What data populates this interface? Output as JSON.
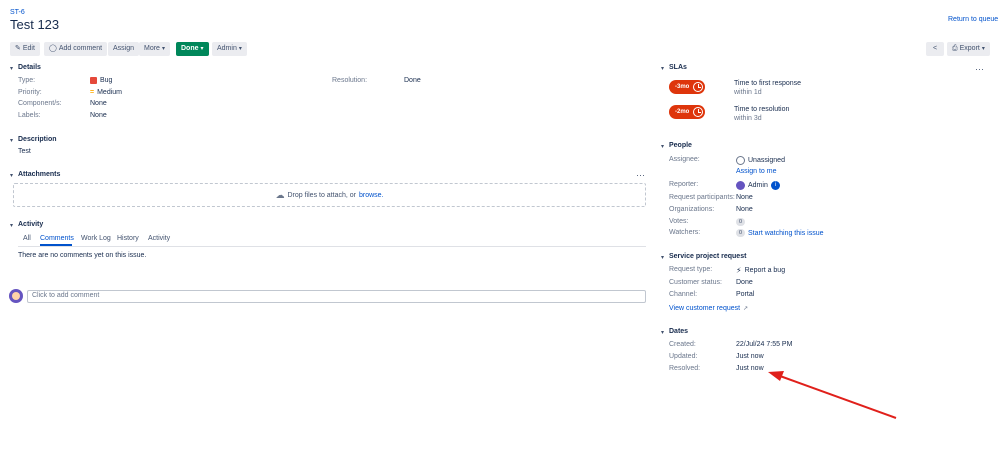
{
  "issue": {
    "key": "ST-6",
    "title": "Test 123",
    "return_link": "Return to queue"
  },
  "toolbar": {
    "edit": "Edit",
    "add_comment": "Add comment",
    "assign": "Assign",
    "more": "More",
    "status": "Done",
    "admin": "Admin",
    "export": "Export"
  },
  "details": {
    "title": "Details",
    "type_label": "Type:",
    "type_value": "Bug",
    "priority_label": "Priority:",
    "priority_value": "Medium",
    "components_label": "Component/s:",
    "components_value": "None",
    "labels_label": "Labels:",
    "labels_value": "None",
    "resolution_label": "Resolution:",
    "resolution_value": "Done"
  },
  "description": {
    "title": "Description",
    "text": "Test"
  },
  "attachments": {
    "title": "Attachments",
    "drop_text": "Drop files to attach, or",
    "browse": "browse."
  },
  "activity": {
    "title": "Activity",
    "tabs": [
      "All",
      "Comments",
      "Work Log",
      "History",
      "Activity"
    ],
    "empty": "There are no comments yet on this issue.",
    "comment_placeholder": "Click to add comment"
  },
  "slas": {
    "title": "SLAs",
    "items": [
      {
        "badge": "-3mo",
        "name": "Time to first response",
        "goal": "within 1d"
      },
      {
        "badge": "-2mo",
        "name": "Time to resolution",
        "goal": "within 3d"
      }
    ]
  },
  "people": {
    "title": "People",
    "assignee_label": "Assignee:",
    "assignee_value": "Unassigned",
    "assign_to_me": "Assign to me",
    "reporter_label": "Reporter:",
    "reporter_value": "Admin",
    "participants_label": "Request participants:",
    "participants_value": "None",
    "organizations_label": "Organizations:",
    "organizations_value": "None",
    "votes_label": "Votes:",
    "votes_value": "0",
    "watchers_label": "Watchers:",
    "watchers_value": "0",
    "watch_link": "Start watching this issue"
  },
  "service_request": {
    "title": "Service project request",
    "type_label": "Request type:",
    "type_value": "Report a bug",
    "status_label": "Customer status:",
    "status_value": "Done",
    "channel_label": "Channel:",
    "channel_value": "Portal",
    "view_link": "View customer request"
  },
  "dates": {
    "title": "Dates",
    "created_label": "Created:",
    "created_value": "22/Jul/24 7:55 PM",
    "updated_label": "Updated:",
    "updated_value": "Just now",
    "resolved_label": "Resolved:",
    "resolved_value": "Just now"
  },
  "colors": {
    "link": "#0052cc",
    "done": "#00875a",
    "sla": "#de350b",
    "bug": "#e5493a",
    "medium": "#ffab00",
    "arrow": "#e0201b"
  }
}
